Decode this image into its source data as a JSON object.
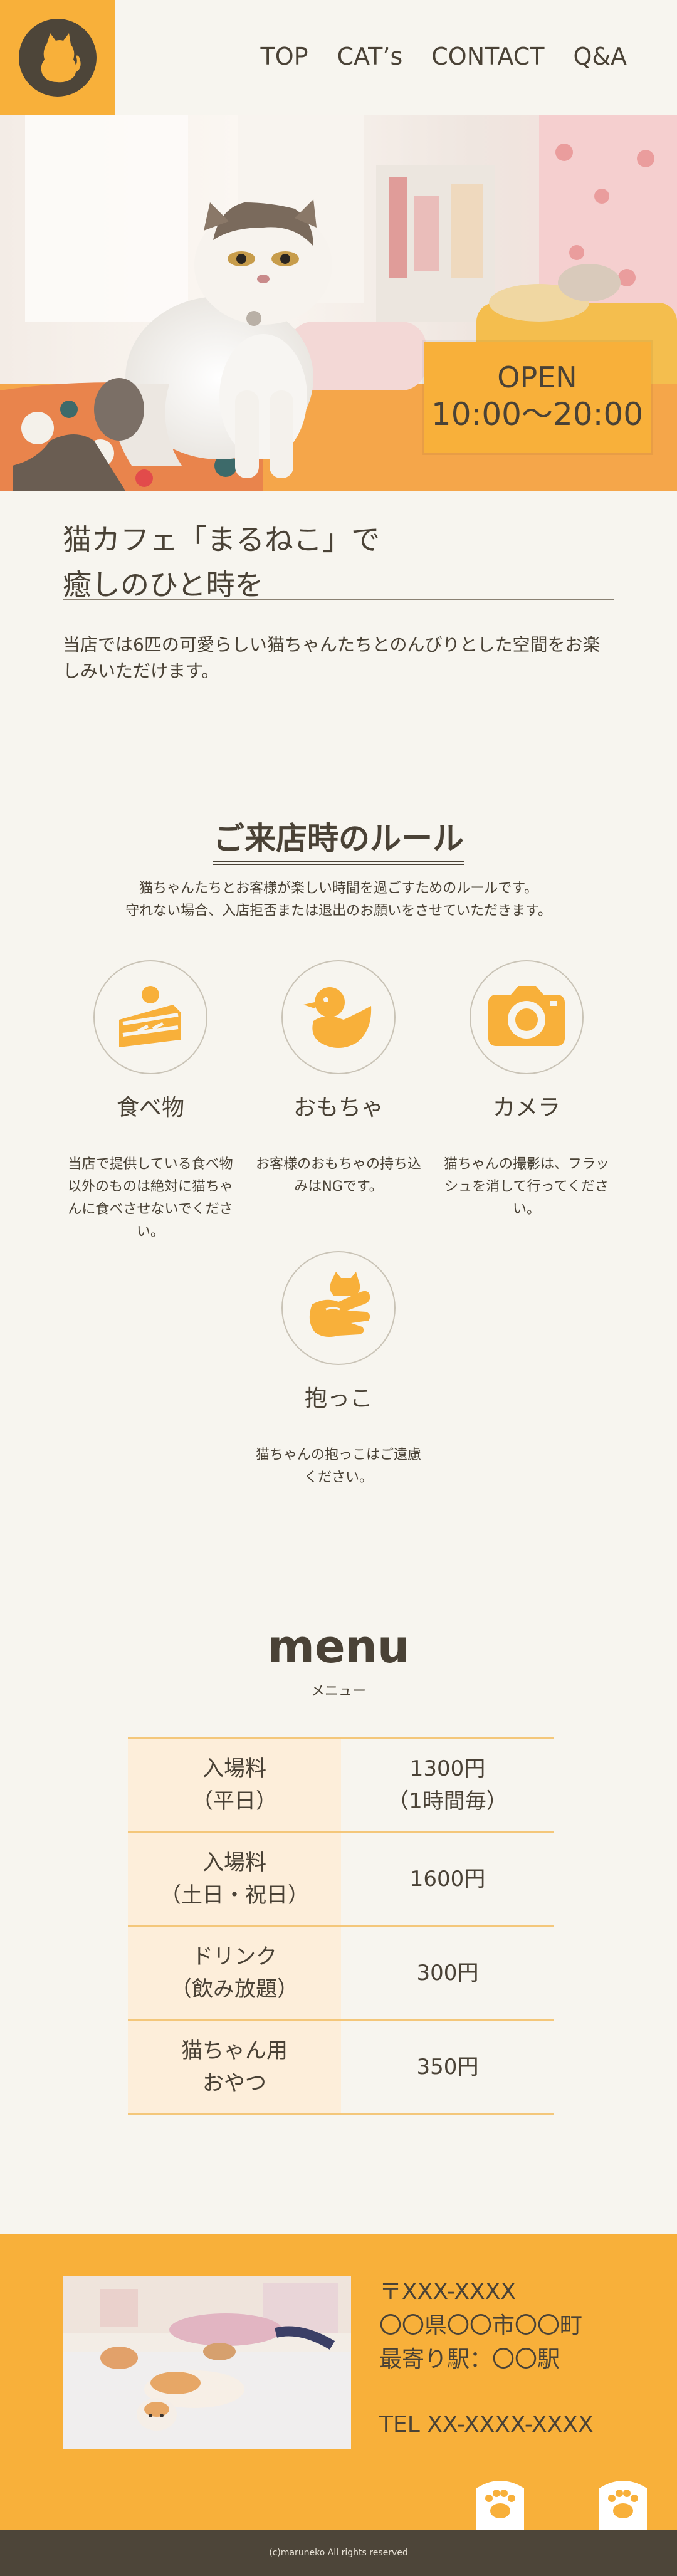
{
  "header": {
    "nav": [
      "TOP",
      "CAT’s",
      "CONTACT",
      "Q&A"
    ]
  },
  "hero": {
    "open_label": "OPEN",
    "hours": "10:00〜20:00"
  },
  "intro": {
    "title_line1": "猫カフェ「まるねこ」で",
    "title_line2": "癒しのひと時を",
    "text": "当店では6匹の可愛らしい猫ちゃんたちとのんびりとした空間をお楽しみいただけます。"
  },
  "rules": {
    "heading": "ご来店時のルール",
    "desc_line1": "猫ちゃんたちとお客様が楽しい時間を過ごすためのルールです。",
    "desc_line2": "守れない場合、入店拒否または退出のお願いをさせていただきます。",
    "items": [
      {
        "icon": "cake-icon",
        "title": "食べ物",
        "text": "当店で提供している食べ物以外のものは絶対に猫ちゃんに食べさせないでください。"
      },
      {
        "icon": "duck-toy-icon",
        "title": "おもちゃ",
        "text": "お客様のおもちゃの持ち込みはNGです。"
      },
      {
        "icon": "camera-icon",
        "title": "カメラ",
        "text": "猫ちゃんの撮影は、フラッシュを消して行ってください。"
      },
      {
        "icon": "hug-cat-icon",
        "title": "抱っこ",
        "text": "猫ちゃんの抱っこはご遠慮ください。"
      }
    ]
  },
  "menu": {
    "title": "menu",
    "subtitle": "メニュー",
    "rows": [
      {
        "name_line1": "入場料",
        "name_line2": "（平日）",
        "price_line1": "1300円",
        "price_line2": "（1時間毎）"
      },
      {
        "name_line1": "入場料",
        "name_line2": "（土日・祝日）",
        "price_line1": "1600円",
        "price_line2": ""
      },
      {
        "name_line1": "ドリンク",
        "name_line2": "（飲み放題）",
        "price_line1": "300円",
        "price_line2": ""
      },
      {
        "name_line1": "猫ちゃん用",
        "name_line2": "おやつ",
        "price_line1": "350円",
        "price_line2": ""
      }
    ]
  },
  "footer": {
    "zip": "〒XXX-XXXX",
    "address": "〇〇県〇〇市〇〇町",
    "station": "最寄り駅：〇〇駅",
    "tel": "TEL XX-XXXX-XXXX",
    "copyright": "(c)maruneko All rights reserved"
  },
  "colors": {
    "accent": "#f8b03a",
    "background": "#f7f5ef",
    "text": "#4a4236",
    "dark": "#4d4539"
  }
}
